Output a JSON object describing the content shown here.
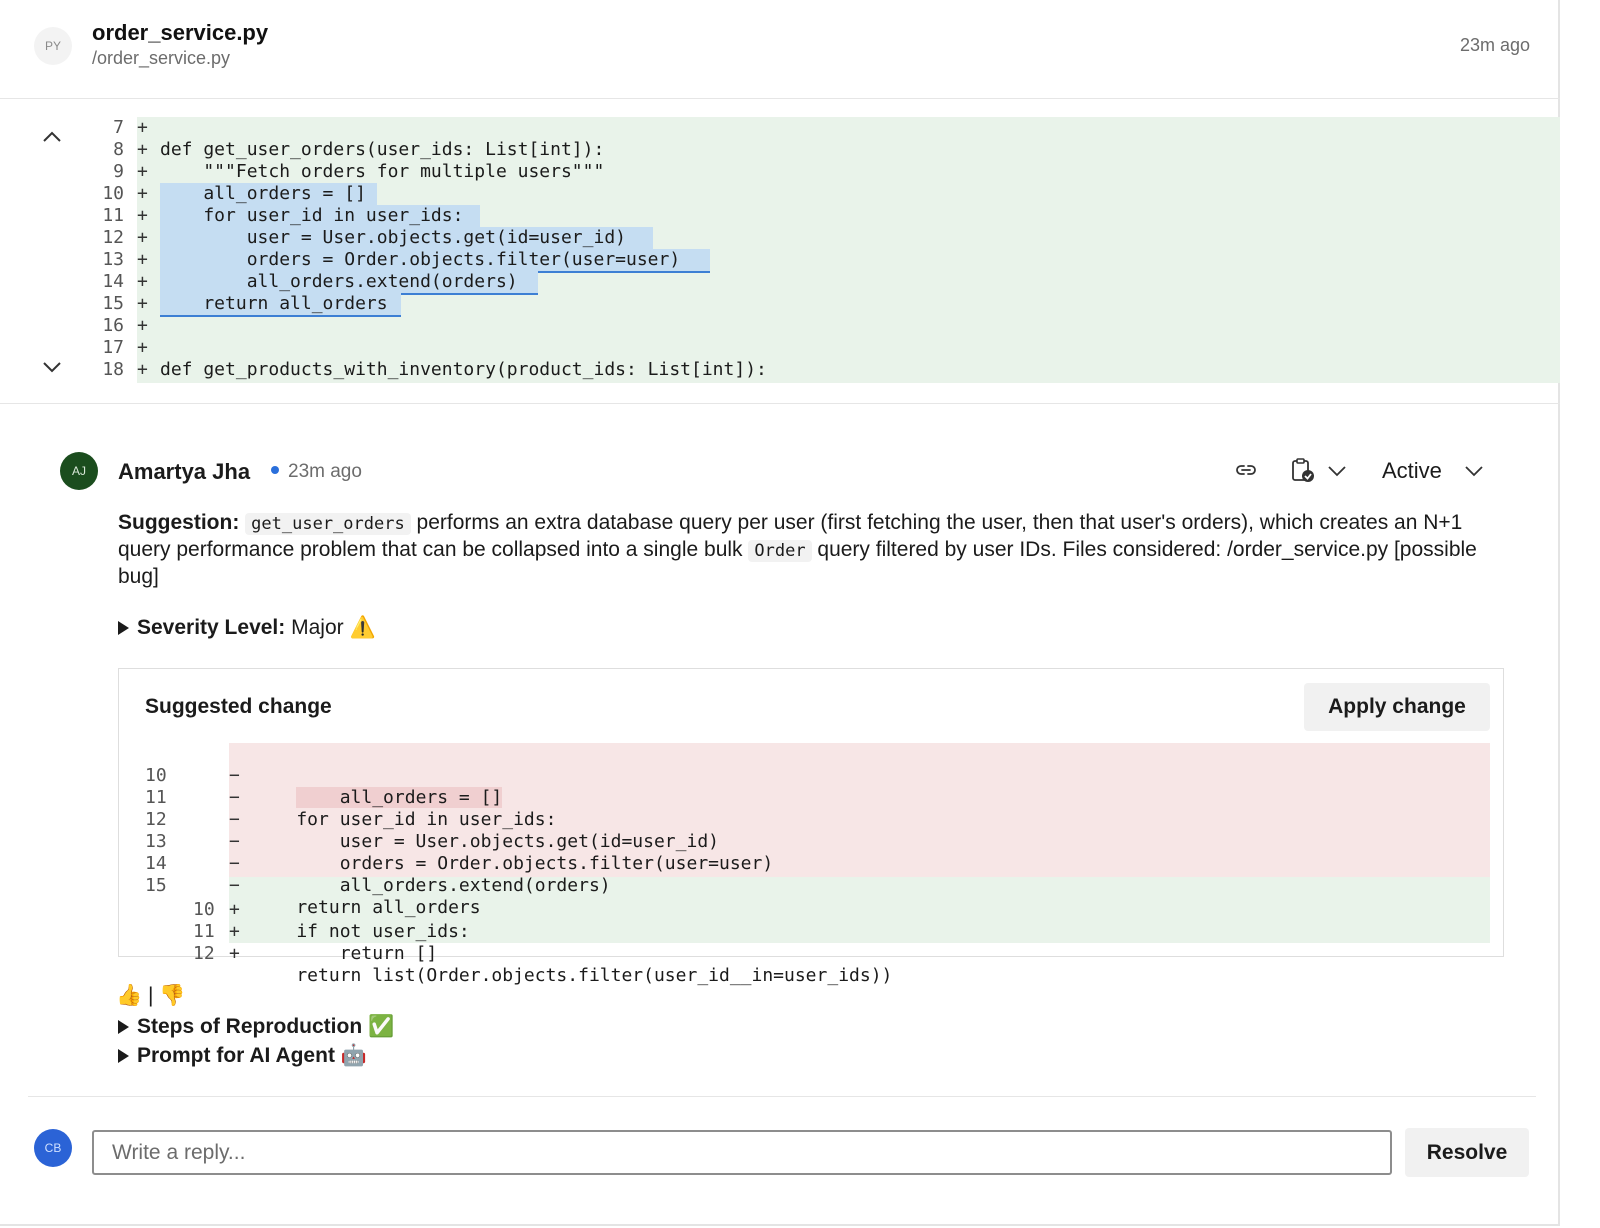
{
  "file": {
    "badge": "PY",
    "name": "order_service.py",
    "path": "/order_service.py",
    "time": "23m ago"
  },
  "context_lines": [
    {
      "num": "7",
      "sign": "+",
      "text": ""
    },
    {
      "num": "8",
      "sign": "+",
      "text": "def get_user_orders(user_ids: List[int]):"
    },
    {
      "num": "9",
      "sign": "+",
      "text": "    \"\"\"Fetch orders for multiple users\"\"\""
    },
    {
      "num": "10",
      "sign": "+",
      "text": "    all_orders = []"
    },
    {
      "num": "11",
      "sign": "+",
      "text": "    for user_id in user_ids:"
    },
    {
      "num": "12",
      "sign": "+",
      "text": "        user = User.objects.get(id=user_id)"
    },
    {
      "num": "13",
      "sign": "+",
      "text": "        orders = Order.objects.filter(user=user)"
    },
    {
      "num": "14",
      "sign": "+",
      "text": "        all_orders.extend(orders)"
    },
    {
      "num": "15",
      "sign": "+",
      "text": "    return all_orders"
    },
    {
      "num": "16",
      "sign": "+",
      "text": ""
    },
    {
      "num": "17",
      "sign": "+",
      "text": ""
    },
    {
      "num": "18",
      "sign": "+",
      "text": "def get_products_with_inventory(product_ids: List[int]):"
    }
  ],
  "comment": {
    "avatar": "AJ",
    "author": "Amartya Jha",
    "time": "23m ago",
    "status": "Active",
    "suggestion_label": "Suggestion:",
    "code1": "get_user_orders",
    "text1": " performs an extra database query per user (first fetching the user, then that user's orders), which creates an N+1 query performance problem that can be collapsed into a single bulk ",
    "code2": "Order",
    "text2": " query filtered by user IDs. Files considered: /order_service.py [possible bug]",
    "severity_label": "Severity Level:",
    "severity_value": " Major ⚠️",
    "reactions": "👍 | 👎",
    "steps": "Steps of Reproduction ✅",
    "prompt": "Prompt for AI Agent 🤖"
  },
  "suggested_change": {
    "title": "Suggested change",
    "apply_label": "Apply change",
    "removed": [
      {
        "num": "10",
        "sign": "−",
        "text": "    all_orders = []"
      },
      {
        "num": "11",
        "sign": "−",
        "text": "    for user_id in user_ids:"
      },
      {
        "num": "12",
        "sign": "−",
        "text": "        user = User.objects.get(id=user_id)"
      },
      {
        "num": "13",
        "sign": "−",
        "text": "        orders = Order.objects.filter(user=user)"
      },
      {
        "num": "14",
        "sign": "−",
        "text": "        all_orders.extend(orders)"
      },
      {
        "num": "15",
        "sign": "−",
        "text": "    return all_orders"
      }
    ],
    "added": [
      {
        "num": "10",
        "sign": "+",
        "text": "    if not user_ids:"
      },
      {
        "num": "11",
        "sign": "+",
        "text": "        return []"
      },
      {
        "num": "12",
        "sign": "+",
        "text": "    return list(Order.objects.filter(user_id__in=user_ids))"
      }
    ]
  },
  "reply": {
    "avatar": "CB",
    "placeholder": "Write a reply...",
    "resolve_label": "Resolve"
  }
}
